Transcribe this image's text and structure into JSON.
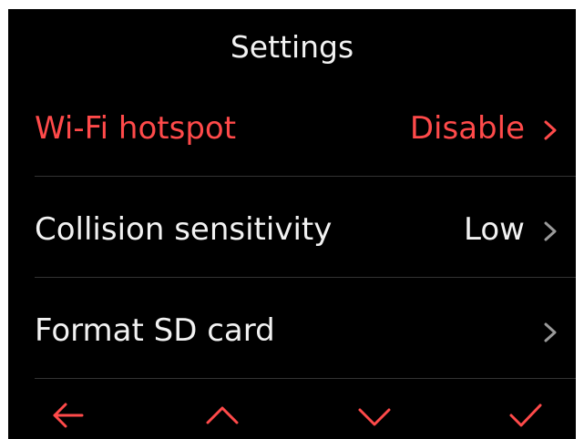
{
  "header": {
    "title": "Settings"
  },
  "settings": {
    "items": [
      {
        "label": "Wi-Fi hotspot",
        "value": "Disable"
      },
      {
        "label": "Collision sensitivity",
        "value": "Low"
      },
      {
        "label": "Format SD card",
        "value": ""
      }
    ],
    "selected_index": 0
  },
  "nav": {
    "buttons": [
      {
        "icon": "arrow-left-icon",
        "action": "back"
      },
      {
        "icon": "chevron-up-icon",
        "action": "up"
      },
      {
        "icon": "chevron-down-icon",
        "action": "down"
      },
      {
        "icon": "checkmark-icon",
        "action": "confirm"
      }
    ]
  },
  "colors": {
    "background": "#000000",
    "text": "#f2f2f2",
    "accent": "#ff4a4a",
    "chevron": "#9a9a9a",
    "divider": "#333333"
  }
}
